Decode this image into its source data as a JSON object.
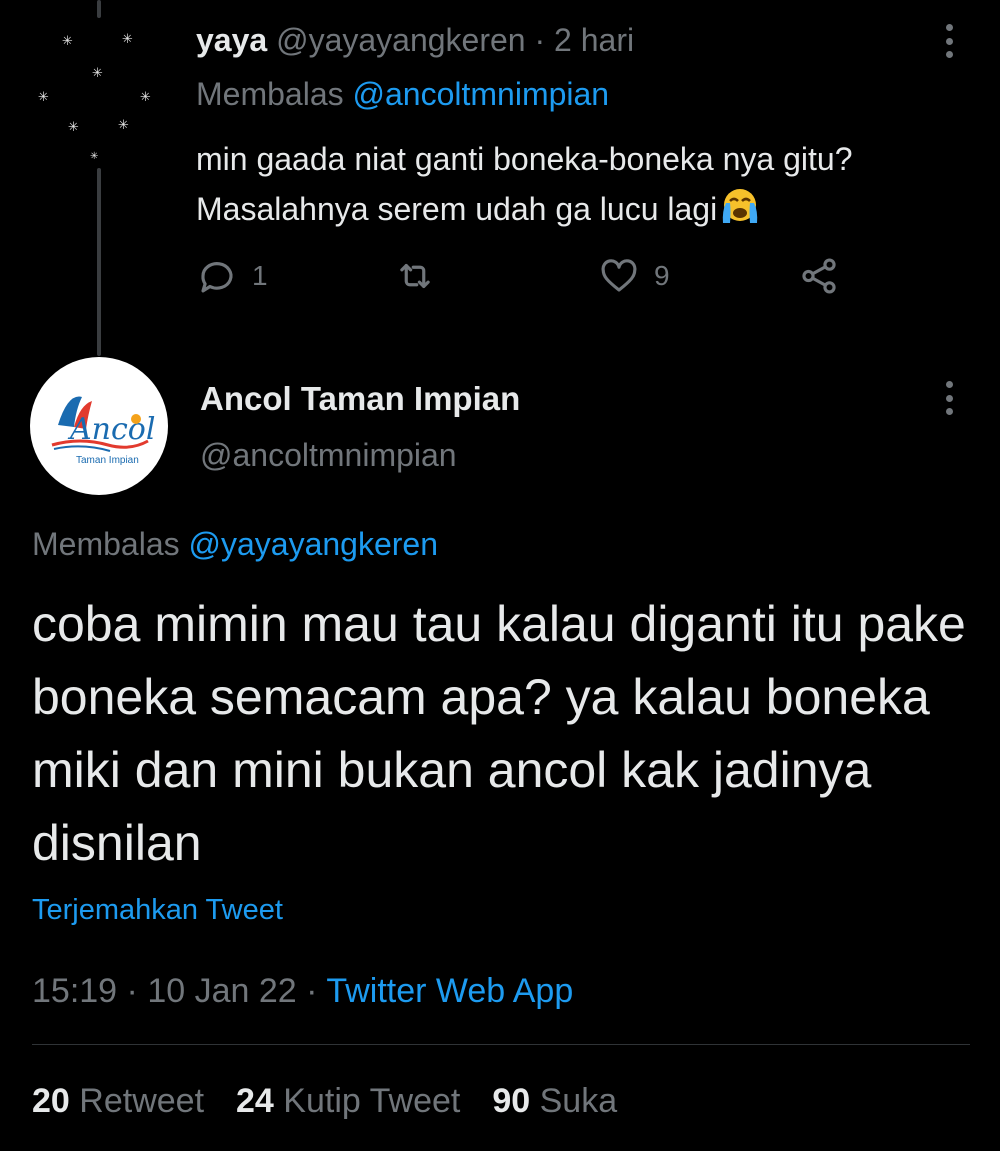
{
  "reply": {
    "name": "yaya",
    "handle": "@yayayangkeren",
    "separator": "·",
    "time": "2 hari",
    "replying_label": "Membalas",
    "replying_to": "@ancoltmnimpian",
    "text_line1": "min gaada niat ganti boneka-boneka nya gitu?",
    "text_line2": "Masalahnya serem udah ga lucu lagi",
    "emoji": "loudly-crying-face-emoji",
    "reply_count": "1",
    "retweet_count": "",
    "like_count": "9"
  },
  "main": {
    "name": "Ancol Taman Impian",
    "handle": "@ancoltmnimpian",
    "avatar_logo_text": "Ancol",
    "avatar_sub_text": "Taman Impian",
    "replying_label": "Membalas",
    "replying_to": "@yayayangkeren",
    "text": "coba mimin mau tau kalau diganti itu pake boneka semacam apa? ya kalau boneka miki dan mini bukan ancol kak jadinya disnilan",
    "translate_label": "Terjemahkan Tweet",
    "time": "15:19",
    "separator": "·",
    "date": "10 Jan 22",
    "source": "Twitter Web App"
  },
  "stats": {
    "retweets_count": "20",
    "retweets_label": "Retweet",
    "quotes_count": "24",
    "quotes_label": "Kutip Tweet",
    "likes_count": "90",
    "likes_label": "Suka"
  },
  "colors": {
    "background": "#000000",
    "text": "#e7e9ea",
    "muted": "#71767b",
    "link": "#1d9bf0"
  }
}
